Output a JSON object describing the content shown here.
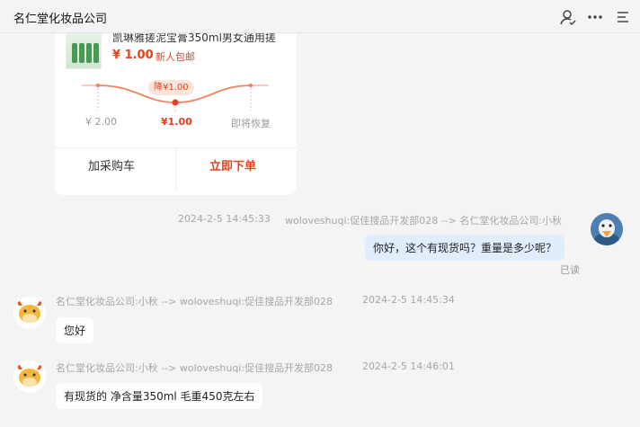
{
  "header": {
    "title": "名仁堂化妆品公司",
    "icons": [
      "user-check-icon",
      "more-icon",
      "menu-icon"
    ]
  },
  "product_card": {
    "name": "凯琳雅搓泥宝膏350ml男女通用搓",
    "price": "¥ 1.00",
    "promo_tag": "新人包邮",
    "drop_badge": "降¥1.00",
    "before_price": "¥ 2.00",
    "current_price": "¥1.00",
    "after_label": "即将恢复",
    "cart_button": "加采购车",
    "buy_button": "立即下单"
  },
  "messages": [
    {
      "side": "right",
      "timestamp": "2024-2-5 14:45:33",
      "route": "woloveshuqi:促佳搜品开发部028 --> 名仁堂化妆品公司:小秋",
      "text": "你好，这个有现货吗？重量是多少呢？",
      "status": "已读"
    },
    {
      "side": "left",
      "route": "名仁堂化妆品公司:小秋 --> woloveshuqi:促佳搜品开发部028",
      "timestamp": "2024-2-5 14:45:34",
      "text": "您好"
    },
    {
      "side": "left",
      "route": "名仁堂化妆品公司:小秋 --> woloveshuqi:促佳搜品开发部028",
      "timestamp": "2024-2-5 14:46:01",
      "text": "有现货的 净含量350ml  毛重450克左右"
    }
  ],
  "colors": {
    "accent": "#e8411d",
    "my_bubble": "#e1ecfd",
    "background": "#f4f4f4"
  }
}
